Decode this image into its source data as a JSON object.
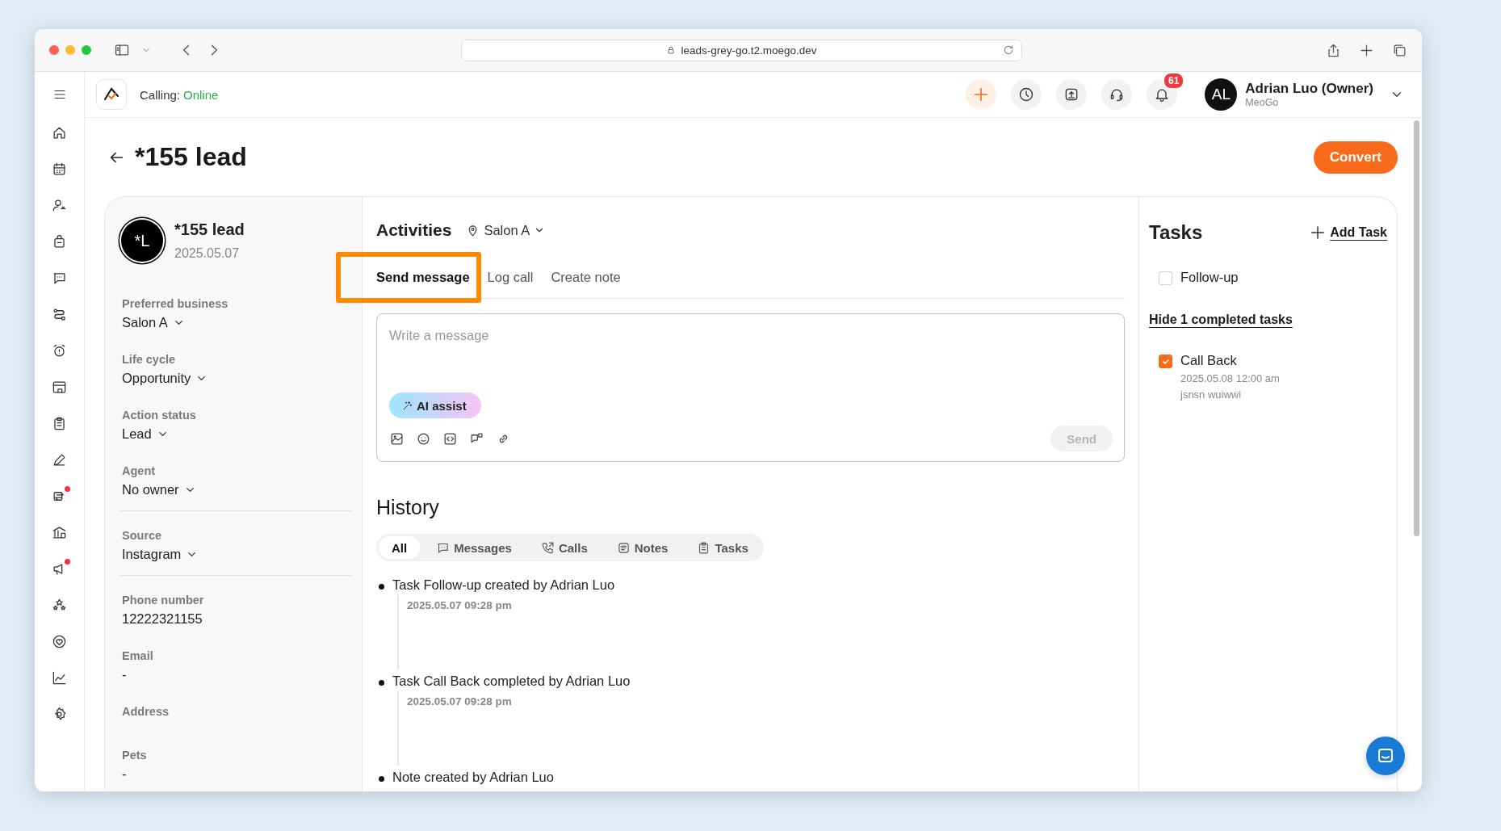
{
  "browser": {
    "url": "leads-grey-go.t2.moego.dev"
  },
  "sidebar": {
    "items": [
      {
        "dot": false
      },
      {
        "dot": false
      },
      {
        "dot": false
      },
      {
        "dot": false
      },
      {
        "dot": false
      },
      {
        "dot": false
      },
      {
        "dot": false
      },
      {
        "dot": false
      },
      {
        "dot": false
      },
      {
        "dot": false
      },
      {
        "dot": true
      },
      {
        "dot": false
      },
      {
        "dot": true
      },
      {
        "dot": false
      },
      {
        "dot": false
      },
      {
        "dot": false
      },
      {
        "dot": false
      }
    ]
  },
  "header": {
    "calling_label": "Calling:",
    "calling_status": "Online",
    "notifications_badge": "61",
    "user": {
      "initials": "AL",
      "name": "Adrian Luo (Owner)",
      "company": "MeoGo"
    }
  },
  "page": {
    "title": "*155 lead",
    "convert_button": "Convert"
  },
  "lead": {
    "initials": "*L",
    "name": "*155 lead",
    "date": "2025.05.07",
    "sections": [
      [
        {
          "label": "Preferred business",
          "value": "Salon A",
          "kind": "dropdown"
        },
        {
          "label": "Life cycle",
          "value": "Opportunity",
          "kind": "dropdown"
        },
        {
          "label": "Action status",
          "value": "Lead",
          "kind": "dropdown"
        },
        {
          "label": "Agent",
          "value": "No owner",
          "kind": "dropdown"
        }
      ],
      [
        {
          "label": "Source",
          "value": "Instagram",
          "kind": "dropdown"
        }
      ],
      [
        {
          "label": "Phone number",
          "value": "12222321155",
          "kind": "text"
        },
        {
          "label": "Email",
          "value": "-",
          "kind": "text"
        },
        {
          "label": "Address",
          "kind": "text"
        },
        {
          "label": "Pets",
          "value": "-",
          "kind": "text"
        }
      ]
    ]
  },
  "activities": {
    "title": "Activities",
    "location": "Salon A",
    "tabs": [
      {
        "label": "Send message",
        "selected": true,
        "highlighted": true
      },
      {
        "label": "Log call",
        "selected": false,
        "highlighted": false
      },
      {
        "label": "Create note",
        "selected": false,
        "highlighted": false
      }
    ],
    "composer": {
      "placeholder": "Write a message",
      "ai_button": "AI assist",
      "send_button": "Send",
      "send_disabled": true
    }
  },
  "history": {
    "title": "History",
    "filters": [
      {
        "label": "All",
        "selected": true
      },
      {
        "label": "Messages",
        "selected": false
      },
      {
        "label": "Calls",
        "selected": false
      },
      {
        "label": "Notes",
        "selected": false
      },
      {
        "label": "Tasks",
        "selected": false
      }
    ],
    "items": [
      {
        "text": "Task Follow-up created by Adrian Luo",
        "time": "2025.05.07 09:28 pm"
      },
      {
        "text": "Task Call Back completed by Adrian Luo",
        "time": "2025.05.07 09:28 pm"
      },
      {
        "text": "Note created by Adrian Luo"
      }
    ]
  },
  "tasks": {
    "title": "Tasks",
    "add_button": "Add Task",
    "open": [
      {
        "label": "Follow-up",
        "checked": false
      }
    ],
    "toggle_link": "Hide 1 completed tasks",
    "completed": [
      {
        "label": "Call Back",
        "checked": true,
        "due": "2025.05.08 12:00 am",
        "note": "jsnsn wuiwwi"
      }
    ]
  }
}
